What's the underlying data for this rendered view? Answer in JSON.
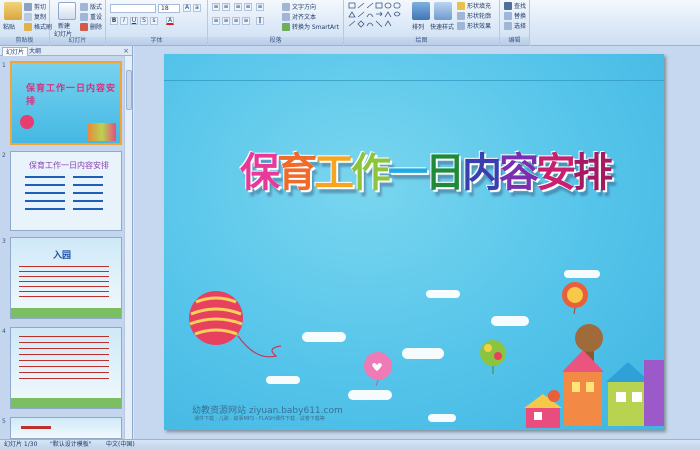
{
  "ribbon": {
    "clipboard": {
      "label": "剪贴板",
      "paste": "粘贴",
      "cut": "剪切",
      "copy": "复制",
      "format_painter": "格式刷"
    },
    "slides": {
      "label": "幻灯片",
      "new_slide": "新建",
      "new_slide_2": "幻灯片",
      "layout": "版式",
      "reset": "重设",
      "delete": "删除"
    },
    "font": {
      "label": "字体",
      "font_size": "18"
    },
    "paragraph": {
      "label": "段落",
      "text_direction": "文字方向",
      "align_text": "对齐文本",
      "smartart": "转换为 SmartArt"
    },
    "drawing": {
      "label": "绘图",
      "arrange": "排列",
      "quick_styles": "快速样式",
      "shape_fill": "形状填充",
      "shape_outline": "形状轮廓",
      "shape_effects": "形状效果"
    },
    "editing": {
      "label": "编辑",
      "find": "查找",
      "replace": "替换",
      "select": "选择"
    }
  },
  "panel": {
    "tab_slides": "幻灯片",
    "tab_outline": "大纲",
    "close": "×"
  },
  "thumbnails": [
    {
      "num": "1",
      "title": "保育工作一日内容安排"
    },
    {
      "num": "2",
      "title": "保育工作一日内容安排"
    },
    {
      "num": "3",
      "title": "入园"
    },
    {
      "num": "4",
      "title": ""
    },
    {
      "num": "5",
      "title": ""
    }
  ],
  "slide": {
    "title_chars": [
      "保",
      "育",
      "工",
      "作",
      "一",
      "日",
      "内",
      "容",
      "安",
      "排"
    ],
    "title_colors": [
      "#e8389a",
      "#f06a2a",
      "#f7a51e",
      "#8bc53f",
      "#21a9e1",
      "#1f8a3a",
      "#3a3fb0",
      "#7a2fb0",
      "#c8206f",
      "#a41a62"
    ],
    "watermark": "幼教资源网站  ziyuan.baby611.com",
    "watermark_sub": "课件下载 · 儿歌 · 故事MP3 · FLASH课件下载 · 试卷下载等"
  },
  "status": {
    "slide_counter": "幻灯片 1/30",
    "theme": "\"默认设计模板\"",
    "language": "中文(中国)"
  }
}
